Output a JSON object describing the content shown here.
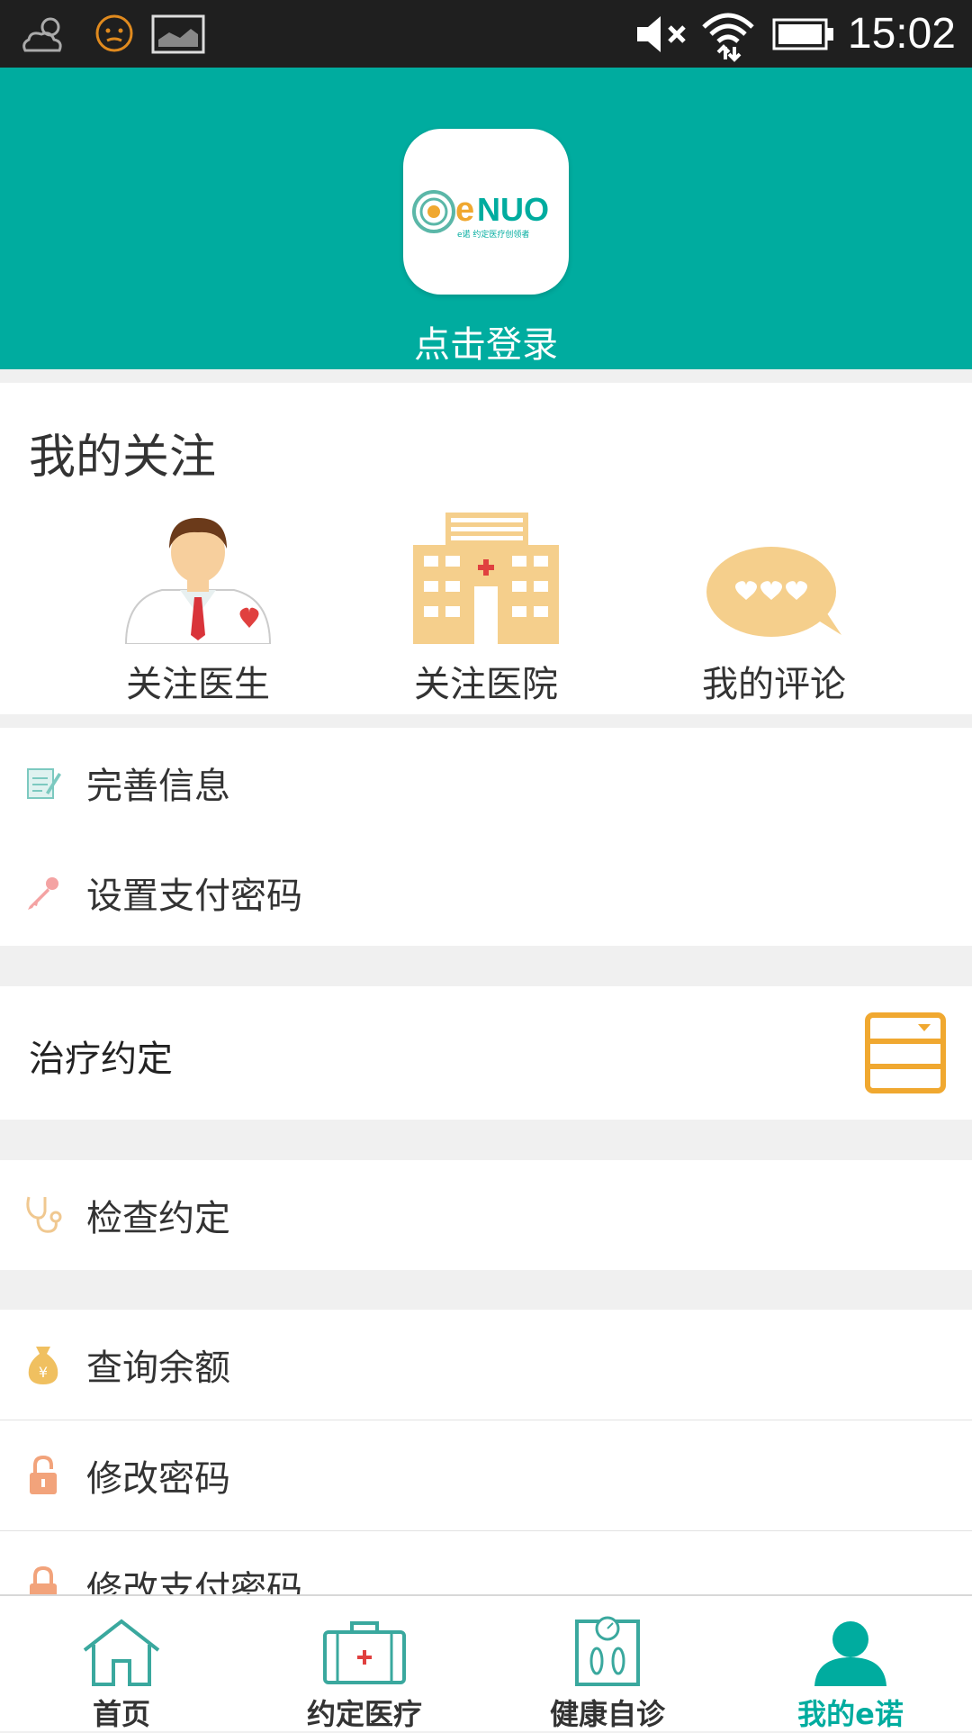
{
  "status_bar": {
    "time": "15:02"
  },
  "header": {
    "login_text": "点击登录",
    "logo_text": "eNUO",
    "logo_tagline": "e诺 约定医疗创领者"
  },
  "favorites": {
    "title": "我的关注",
    "items": [
      {
        "label": "关注医生",
        "icon": "doctor-icon"
      },
      {
        "label": "关注医院",
        "icon": "hospital-icon"
      },
      {
        "label": "我的评论",
        "icon": "comment-bubble-icon"
      }
    ]
  },
  "menu_group1": [
    {
      "label": "完善信息",
      "icon": "edit-note-icon"
    },
    {
      "label": "设置支付密码",
      "icon": "key-icon"
    }
  ],
  "treatment": {
    "label": "治疗约定",
    "icon": "cabinet-icon"
  },
  "exam": {
    "label": "检查约定",
    "icon": "stethoscope-icon"
  },
  "menu_group3": [
    {
      "label": "查询余额",
      "icon": "money-bag-icon"
    },
    {
      "label": "修改密码",
      "icon": "lock-icon"
    },
    {
      "label": "修改支付密码",
      "icon": "lock-icon"
    }
  ],
  "bottom_nav": [
    {
      "label": "首页",
      "icon": "home-icon"
    },
    {
      "label": "约定医疗",
      "icon": "medical-kit-icon"
    },
    {
      "label": "健康自诊",
      "icon": "scale-icon"
    },
    {
      "label": "我的e诺",
      "icon": "user-icon",
      "active": true
    }
  ],
  "colors": {
    "primary": "#00ac9f",
    "accent_orange": "#f0a830",
    "icon_tan": "#f5cf8c",
    "background": "#f0f0f0"
  }
}
